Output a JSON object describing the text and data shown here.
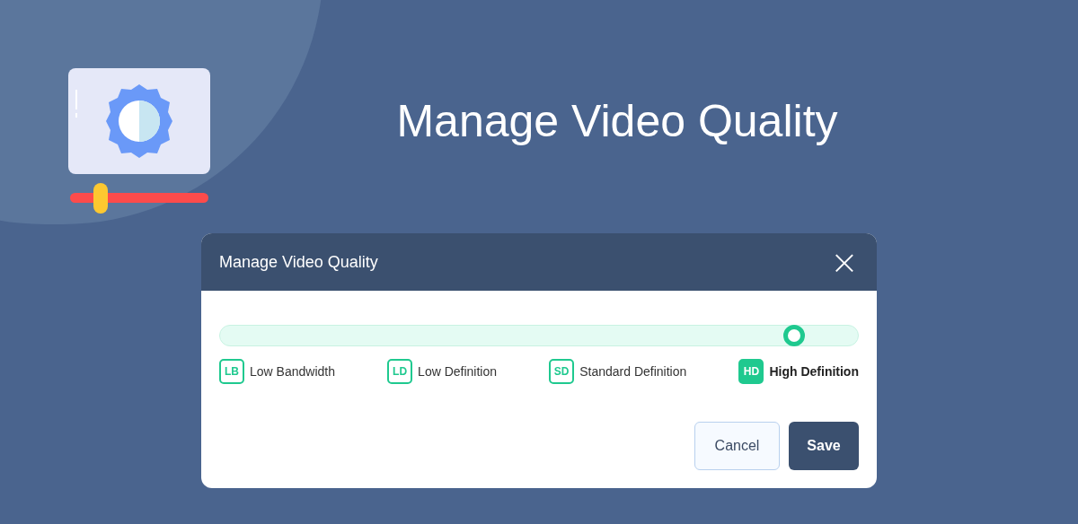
{
  "hero": {
    "title": "Manage Video Quality"
  },
  "dialog": {
    "title": "Manage Video Quality",
    "close": "×",
    "slider": {
      "level": 0.9
    },
    "options": [
      {
        "badge": "LB",
        "label": "Low Bandwidth",
        "selected": false
      },
      {
        "badge": "LD",
        "label": "Low Definition",
        "selected": false
      },
      {
        "badge": "SD",
        "label": "Standard Definition",
        "selected": false
      },
      {
        "badge": "HD",
        "label": "High Definition",
        "selected": true
      }
    ],
    "buttons": [
      {
        "label": "Cancel",
        "kind": "secondary"
      },
      {
        "label": "Save",
        "kind": "primary"
      }
    ]
  }
}
